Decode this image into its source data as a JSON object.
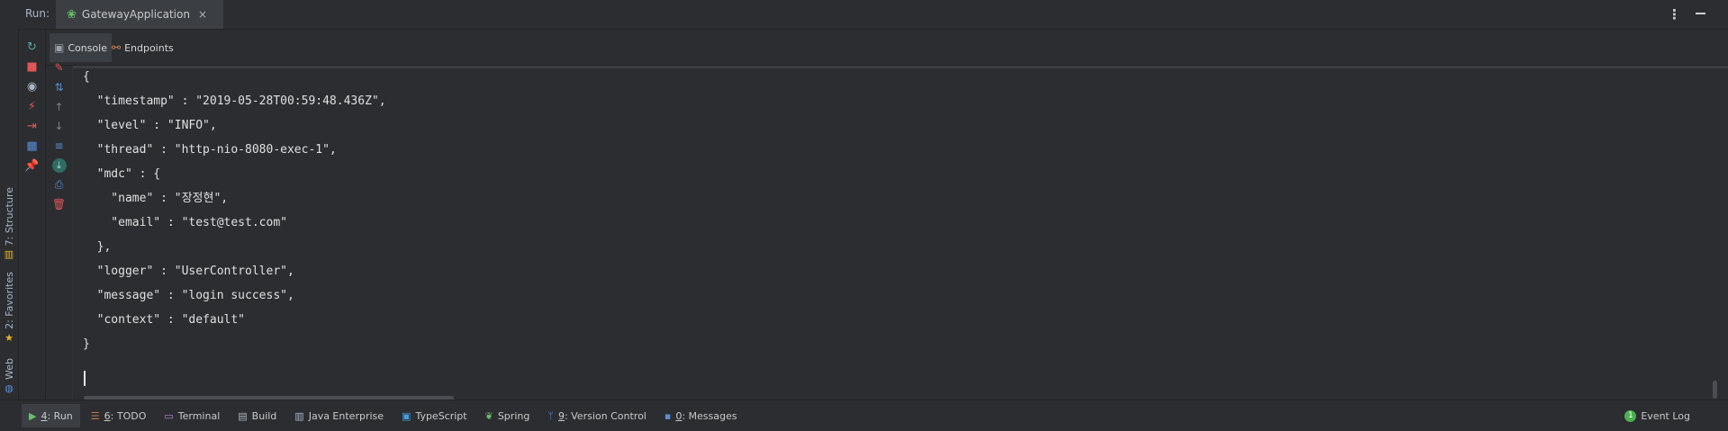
{
  "header": {
    "run_label": "Run:",
    "tab": {
      "label": "GatewayApplication",
      "close": "×"
    }
  },
  "left_strip": {
    "tabs": [
      {
        "label": "7: Structure",
        "icon": "structure-icon"
      },
      {
        "label": "2: Favorites",
        "icon": "star-icon"
      },
      {
        "label": "Web",
        "icon": "web-icon"
      }
    ]
  },
  "subtabs": [
    {
      "label": "Console",
      "icon": "console-icon",
      "active": true
    },
    {
      "label": "Endpoints",
      "icon": "endpoints-icon",
      "active": false
    }
  ],
  "action_buttons": [
    {
      "icon": "rerun-icon",
      "glyph": "↻",
      "color": "#4fa8a0"
    },
    {
      "icon": "stop-icon",
      "glyph": "■",
      "color": "#e05555"
    },
    {
      "icon": "camera-icon",
      "glyph": "◉",
      "color": "#a9b7c6"
    },
    {
      "icon": "plug-icon",
      "glyph": "⚡",
      "color": "#e05555"
    },
    {
      "icon": "exit-icon",
      "glyph": "⇥",
      "color": "#e05555"
    },
    {
      "icon": "layout-icon",
      "glyph": "▦",
      "color": "#5a8fd6"
    },
    {
      "icon": "pin-icon",
      "glyph": "📌",
      "color": "#e07ab8"
    }
  ],
  "gutter_buttons": [
    {
      "icon": "clear-brush-icon",
      "glyph": "✎",
      "color": "#e05555"
    },
    {
      "icon": "sort-icon",
      "glyph": "⇅",
      "color": "#5a8fd6"
    },
    {
      "icon": "up-arrow-icon",
      "glyph": "↑",
      "color": "#7d8186"
    },
    {
      "icon": "down-arrow-icon",
      "glyph": "↓",
      "color": "#7d8186"
    },
    {
      "icon": "soft-wrap-icon",
      "glyph": "≡",
      "color": "#5a8fd6"
    },
    {
      "icon": "scroll-to-end-icon",
      "glyph": "⤓",
      "color": "#4fb89a"
    },
    {
      "icon": "print-icon",
      "glyph": "⎙",
      "color": "#5a8fd6"
    },
    {
      "icon": "trash-icon",
      "glyph": "🗑",
      "color": "#e05555"
    }
  ],
  "console_lines": [
    "{",
    "  \"timestamp\" : \"2019-05-28T00:59:48.436Z\",",
    "  \"level\" : \"INFO\",",
    "  \"thread\" : \"http-nio-8080-exec-1\",",
    "  \"mdc\" : {",
    "    \"name\" : \"장정현\",",
    "    \"email\" : \"test@test.com\"",
    "  },",
    "  \"logger\" : \"UserController\",",
    "  \"message\" : \"login success\",",
    "  \"context\" : \"default\"",
    "}"
  ],
  "bottom_bar": {
    "items": [
      {
        "mnemonic": "4",
        "rest": ": Run",
        "icon": "run-icon",
        "glyph": "▶",
        "active": true
      },
      {
        "mnemonic": "6",
        "rest": ": TODO",
        "icon": "todo-icon",
        "glyph": "☰",
        "active": false
      },
      {
        "mnemonic": "",
        "rest": "Terminal",
        "icon": "terminal-icon",
        "glyph": "▭",
        "active": false
      },
      {
        "mnemonic": "",
        "rest": "Build",
        "icon": "build-icon",
        "glyph": "▤",
        "active": false
      },
      {
        "mnemonic": "",
        "rest": "Java Enterprise",
        "icon": "java-enterprise-icon",
        "glyph": "▥",
        "active": false
      },
      {
        "mnemonic": "",
        "rest": "TypeScript",
        "icon": "typescript-icon",
        "glyph": "▣",
        "active": false
      },
      {
        "mnemonic": "",
        "rest": "Spring",
        "icon": "spring-icon",
        "glyph": "❦",
        "active": false
      },
      {
        "mnemonic": "9",
        "rest": ": Version Control",
        "icon": "version-control-icon",
        "glyph": "ᛘ",
        "active": false
      },
      {
        "mnemonic": "0",
        "rest": ": Messages",
        "icon": "messages-icon",
        "glyph": "▪",
        "active": false
      }
    ],
    "event_log": {
      "label": "Event Log",
      "badge": "1"
    }
  },
  "colors": {
    "background": "#2b2d30",
    "active_tab": "#3b3f44",
    "console_text": "#e0e0e0"
  }
}
